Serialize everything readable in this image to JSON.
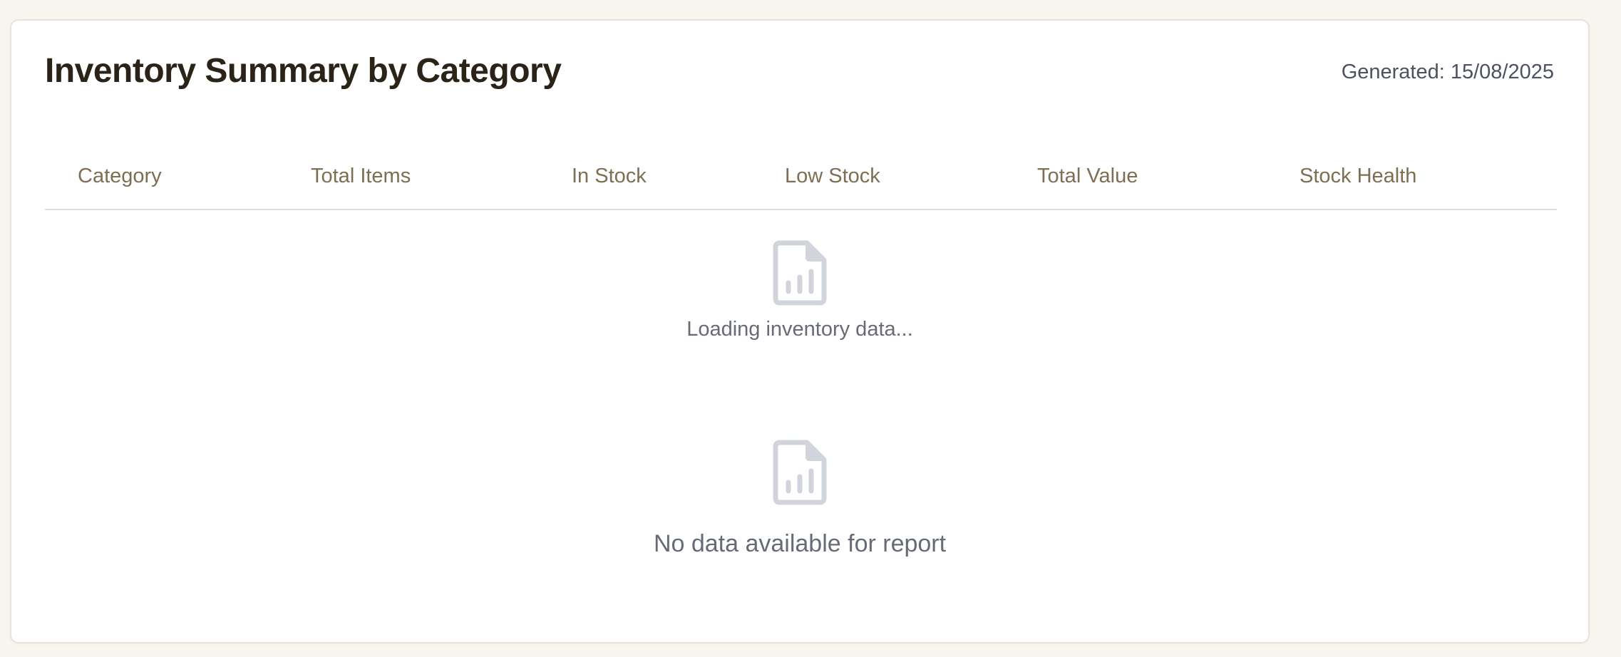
{
  "report": {
    "title": "Inventory Summary by Category",
    "generated": "Generated: 15/08/2025"
  },
  "table": {
    "columns": [
      "Category",
      "Total Items",
      "In Stock",
      "Low Stock",
      "Total Value",
      "Stock Health"
    ]
  },
  "loading_state": {
    "icon": "document-chart-icon",
    "message": "Loading inventory data..."
  },
  "empty_state": {
    "icon": "document-chart-icon",
    "message": "No data available for report"
  },
  "colors": {
    "background": "#f7f5ee",
    "card": "#ffffff",
    "title": "#2b2218",
    "column_header": "#7d6e54",
    "muted_text": "#666b76",
    "icon": "#d1d5db"
  }
}
